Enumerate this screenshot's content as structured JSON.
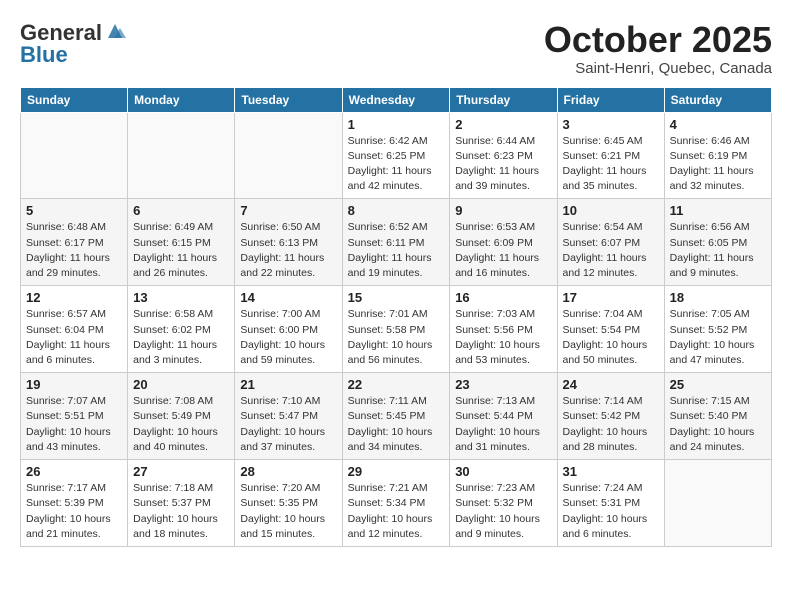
{
  "header": {
    "logo_general": "General",
    "logo_blue": "Blue",
    "month": "October 2025",
    "location": "Saint-Henri, Quebec, Canada"
  },
  "weekdays": [
    "Sunday",
    "Monday",
    "Tuesday",
    "Wednesday",
    "Thursday",
    "Friday",
    "Saturday"
  ],
  "weeks": [
    [
      {
        "day": "",
        "info": ""
      },
      {
        "day": "",
        "info": ""
      },
      {
        "day": "",
        "info": ""
      },
      {
        "day": "1",
        "info": "Sunrise: 6:42 AM\nSunset: 6:25 PM\nDaylight: 11 hours\nand 42 minutes."
      },
      {
        "day": "2",
        "info": "Sunrise: 6:44 AM\nSunset: 6:23 PM\nDaylight: 11 hours\nand 39 minutes."
      },
      {
        "day": "3",
        "info": "Sunrise: 6:45 AM\nSunset: 6:21 PM\nDaylight: 11 hours\nand 35 minutes."
      },
      {
        "day": "4",
        "info": "Sunrise: 6:46 AM\nSunset: 6:19 PM\nDaylight: 11 hours\nand 32 minutes."
      }
    ],
    [
      {
        "day": "5",
        "info": "Sunrise: 6:48 AM\nSunset: 6:17 PM\nDaylight: 11 hours\nand 29 minutes."
      },
      {
        "day": "6",
        "info": "Sunrise: 6:49 AM\nSunset: 6:15 PM\nDaylight: 11 hours\nand 26 minutes."
      },
      {
        "day": "7",
        "info": "Sunrise: 6:50 AM\nSunset: 6:13 PM\nDaylight: 11 hours\nand 22 minutes."
      },
      {
        "day": "8",
        "info": "Sunrise: 6:52 AM\nSunset: 6:11 PM\nDaylight: 11 hours\nand 19 minutes."
      },
      {
        "day": "9",
        "info": "Sunrise: 6:53 AM\nSunset: 6:09 PM\nDaylight: 11 hours\nand 16 minutes."
      },
      {
        "day": "10",
        "info": "Sunrise: 6:54 AM\nSunset: 6:07 PM\nDaylight: 11 hours\nand 12 minutes."
      },
      {
        "day": "11",
        "info": "Sunrise: 6:56 AM\nSunset: 6:05 PM\nDaylight: 11 hours\nand 9 minutes."
      }
    ],
    [
      {
        "day": "12",
        "info": "Sunrise: 6:57 AM\nSunset: 6:04 PM\nDaylight: 11 hours\nand 6 minutes."
      },
      {
        "day": "13",
        "info": "Sunrise: 6:58 AM\nSunset: 6:02 PM\nDaylight: 11 hours\nand 3 minutes."
      },
      {
        "day": "14",
        "info": "Sunrise: 7:00 AM\nSunset: 6:00 PM\nDaylight: 10 hours\nand 59 minutes."
      },
      {
        "day": "15",
        "info": "Sunrise: 7:01 AM\nSunset: 5:58 PM\nDaylight: 10 hours\nand 56 minutes."
      },
      {
        "day": "16",
        "info": "Sunrise: 7:03 AM\nSunset: 5:56 PM\nDaylight: 10 hours\nand 53 minutes."
      },
      {
        "day": "17",
        "info": "Sunrise: 7:04 AM\nSunset: 5:54 PM\nDaylight: 10 hours\nand 50 minutes."
      },
      {
        "day": "18",
        "info": "Sunrise: 7:05 AM\nSunset: 5:52 PM\nDaylight: 10 hours\nand 47 minutes."
      }
    ],
    [
      {
        "day": "19",
        "info": "Sunrise: 7:07 AM\nSunset: 5:51 PM\nDaylight: 10 hours\nand 43 minutes."
      },
      {
        "day": "20",
        "info": "Sunrise: 7:08 AM\nSunset: 5:49 PM\nDaylight: 10 hours\nand 40 minutes."
      },
      {
        "day": "21",
        "info": "Sunrise: 7:10 AM\nSunset: 5:47 PM\nDaylight: 10 hours\nand 37 minutes."
      },
      {
        "day": "22",
        "info": "Sunrise: 7:11 AM\nSunset: 5:45 PM\nDaylight: 10 hours\nand 34 minutes."
      },
      {
        "day": "23",
        "info": "Sunrise: 7:13 AM\nSunset: 5:44 PM\nDaylight: 10 hours\nand 31 minutes."
      },
      {
        "day": "24",
        "info": "Sunrise: 7:14 AM\nSunset: 5:42 PM\nDaylight: 10 hours\nand 28 minutes."
      },
      {
        "day": "25",
        "info": "Sunrise: 7:15 AM\nSunset: 5:40 PM\nDaylight: 10 hours\nand 24 minutes."
      }
    ],
    [
      {
        "day": "26",
        "info": "Sunrise: 7:17 AM\nSunset: 5:39 PM\nDaylight: 10 hours\nand 21 minutes."
      },
      {
        "day": "27",
        "info": "Sunrise: 7:18 AM\nSunset: 5:37 PM\nDaylight: 10 hours\nand 18 minutes."
      },
      {
        "day": "28",
        "info": "Sunrise: 7:20 AM\nSunset: 5:35 PM\nDaylight: 10 hours\nand 15 minutes."
      },
      {
        "day": "29",
        "info": "Sunrise: 7:21 AM\nSunset: 5:34 PM\nDaylight: 10 hours\nand 12 minutes."
      },
      {
        "day": "30",
        "info": "Sunrise: 7:23 AM\nSunset: 5:32 PM\nDaylight: 10 hours\nand 9 minutes."
      },
      {
        "day": "31",
        "info": "Sunrise: 7:24 AM\nSunset: 5:31 PM\nDaylight: 10 hours\nand 6 minutes."
      },
      {
        "day": "",
        "info": ""
      }
    ]
  ]
}
